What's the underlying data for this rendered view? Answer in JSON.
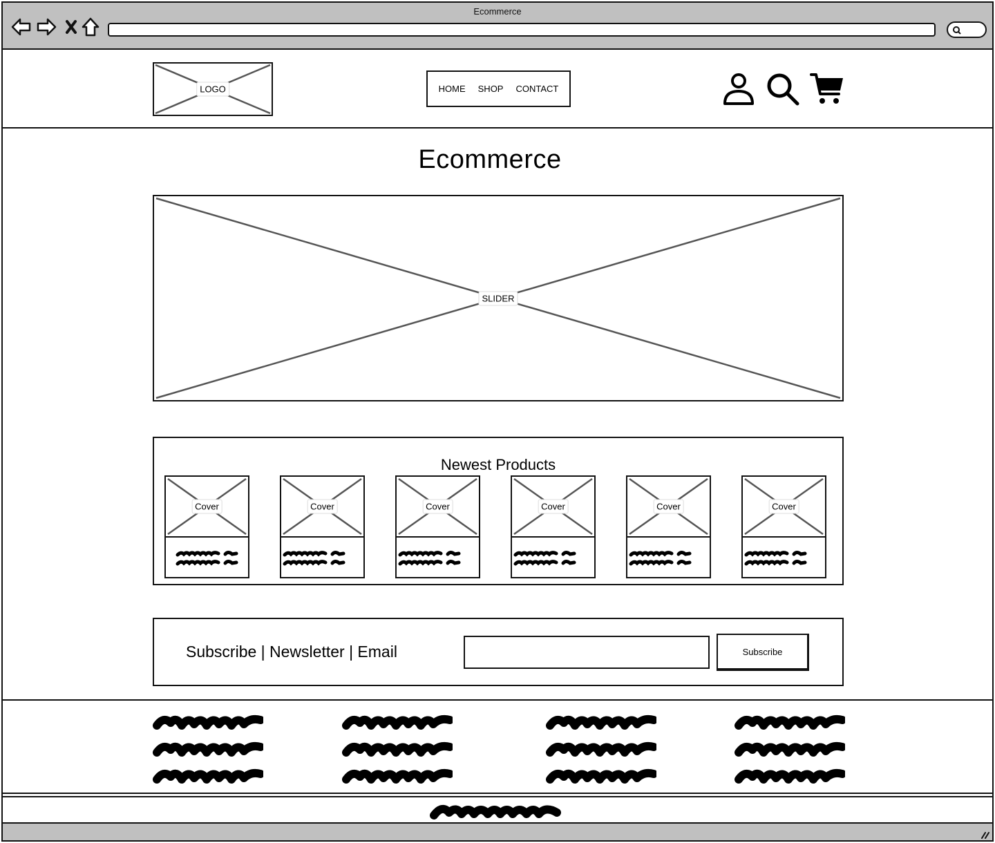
{
  "browser": {
    "title": "Ecommerce",
    "icons": {
      "back": "arrow-left-icon",
      "forward": "arrow-right-icon",
      "stop": "close-icon",
      "home": "home-icon",
      "search": "search-icon"
    },
    "url": ""
  },
  "header": {
    "logo_label": "LOGO",
    "nav": [
      {
        "label": "HOME"
      },
      {
        "label": "SHOP"
      },
      {
        "label": "CONTACT"
      }
    ],
    "icons": [
      "user-icon",
      "search-icon",
      "cart-icon"
    ]
  },
  "main": {
    "title": "Ecommerce",
    "slider_label": "SLIDER",
    "newest": {
      "title": "Newest Products",
      "products": [
        {
          "cover_label": "Cover"
        },
        {
          "cover_label": "Cover"
        },
        {
          "cover_label": "Cover"
        },
        {
          "cover_label": "Cover"
        },
        {
          "cover_label": "Cover"
        },
        {
          "cover_label": "Cover"
        }
      ]
    },
    "subscribe": {
      "text": "Subscribe | Newsletter | Email",
      "input_value": "",
      "input_placeholder": "",
      "button_label": "Subscribe"
    }
  },
  "footer": {
    "columns": 4,
    "lines_per_column": 3
  },
  "colors": {
    "chrome": "#c0c0c0",
    "stroke": "#111111",
    "placeholder_cross": "#555555"
  }
}
